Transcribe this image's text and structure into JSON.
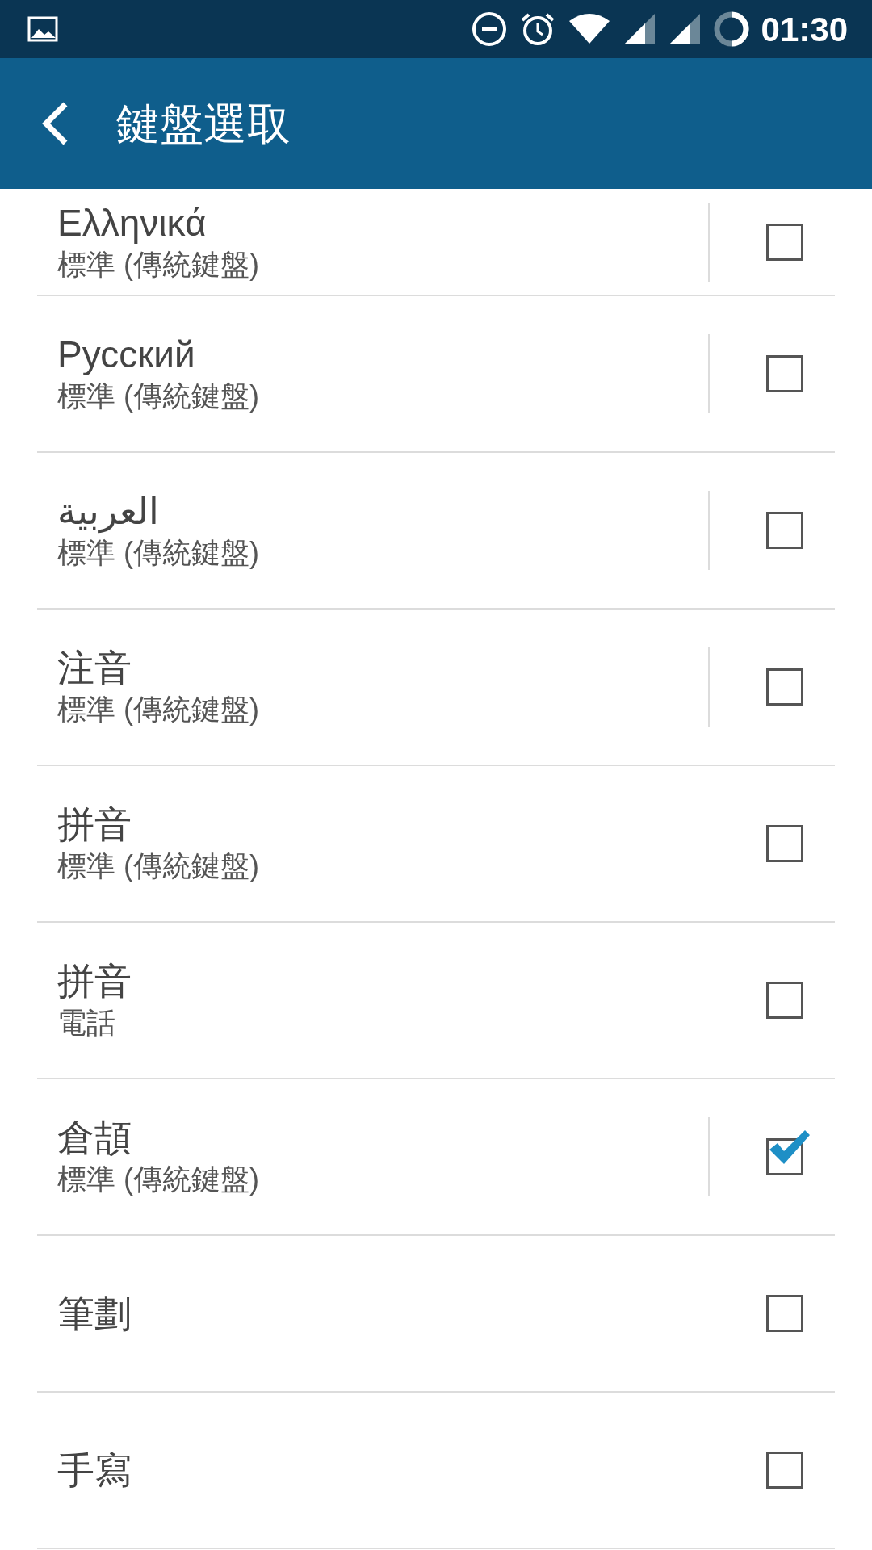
{
  "status_bar": {
    "time": "01:30"
  },
  "app_bar": {
    "title": "鍵盤選取"
  },
  "keyboards": [
    {
      "name": "Ελληνικά",
      "layout": "標準 (傳統鍵盤)",
      "has_settings": true,
      "checked": false
    },
    {
      "name": "Русский",
      "layout": "標準 (傳統鍵盤)",
      "has_settings": true,
      "checked": false
    },
    {
      "name": "العربية",
      "layout": "標準 (傳統鍵盤)",
      "has_settings": true,
      "checked": false
    },
    {
      "name": "注音",
      "layout": "標準 (傳統鍵盤)",
      "has_settings": true,
      "checked": false
    },
    {
      "name": "拼音",
      "layout": "標準 (傳統鍵盤)",
      "has_settings": false,
      "checked": false
    },
    {
      "name": "拼音",
      "layout": "電話",
      "has_settings": false,
      "checked": false
    },
    {
      "name": "倉頡",
      "layout": "標準 (傳統鍵盤)",
      "has_settings": true,
      "checked": true
    },
    {
      "name": "筆劃",
      "has_settings": false,
      "checked": false
    },
    {
      "name": "手寫",
      "has_settings": false,
      "checked": false
    }
  ]
}
